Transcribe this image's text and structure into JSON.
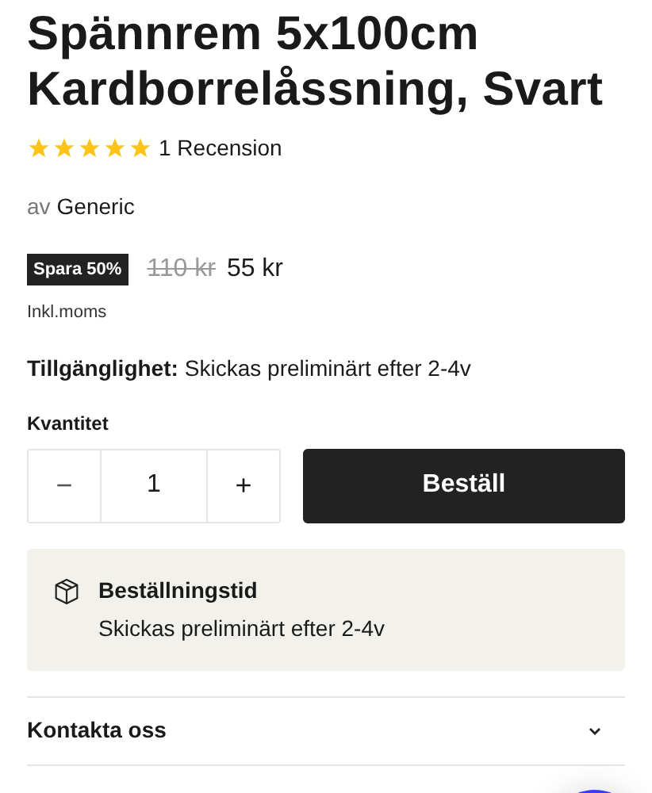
{
  "title": "Spännrem 5x100cm Kardborrelåssning, Svart",
  "rating": {
    "stars": 5,
    "label": "1 Recension"
  },
  "vendor": {
    "prefix": "av",
    "name": "Generic"
  },
  "price": {
    "badge": "Spara 50%",
    "old": "110 kr",
    "current": "55 kr",
    "tax_note": "Inkl.moms"
  },
  "availability": {
    "label": "Tillgänglighet:",
    "value": "Skickas preliminärt efter 2-4v"
  },
  "quantity": {
    "label": "Kvantitet",
    "minus": "−",
    "value": "1",
    "plus": "+"
  },
  "order_button": "Beställ",
  "delivery_info": {
    "title": "Beställningstid",
    "text": "Skickas preliminärt efter 2-4v"
  },
  "accordion": [
    {
      "label": "Kontakta oss",
      "expanded": false
    }
  ]
}
